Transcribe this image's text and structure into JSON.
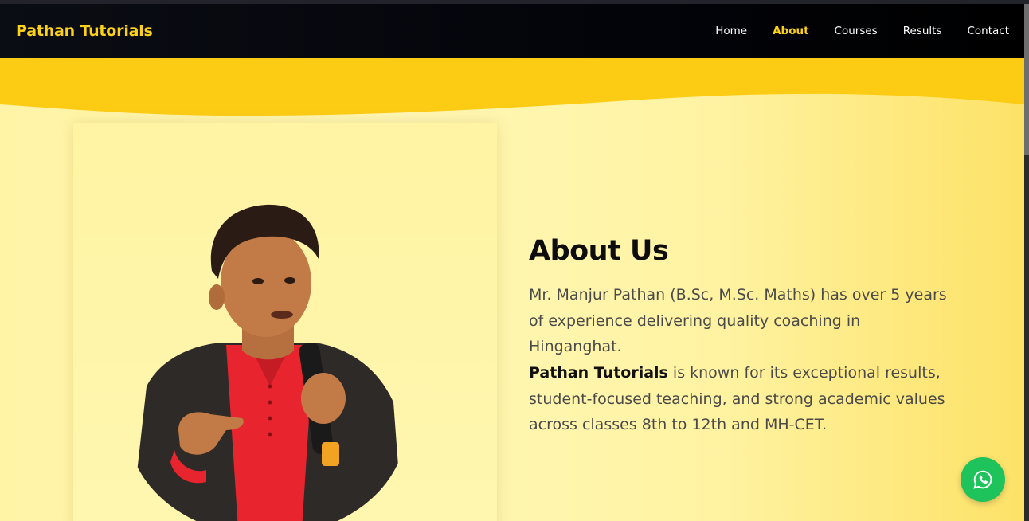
{
  "navbar": {
    "brand": "Pathan Tutorials",
    "links": [
      {
        "label": "Home",
        "active": false
      },
      {
        "label": "About",
        "active": true
      },
      {
        "label": "Courses",
        "active": false
      },
      {
        "label": "Results",
        "active": false
      },
      {
        "label": "Contact",
        "active": false
      }
    ]
  },
  "about": {
    "title": "About Us",
    "paragraph1": "Mr. Manjur Pathan (B.Sc, M.Sc. Maths) has over 5 years of experience delivering quality coaching in Hinganghat.",
    "paragraph2_strong": "Pathan Tutorials",
    "paragraph2_rest": " is known for its exceptional results, student-focused teaching, and strong academic values across classes 8th to 12th and MH-CET."
  },
  "floating": {
    "icon": "whatsapp-icon"
  },
  "colors": {
    "accent": "#fcd117",
    "navbar_bg": "#000000",
    "whatsapp": "#1fc35b"
  }
}
